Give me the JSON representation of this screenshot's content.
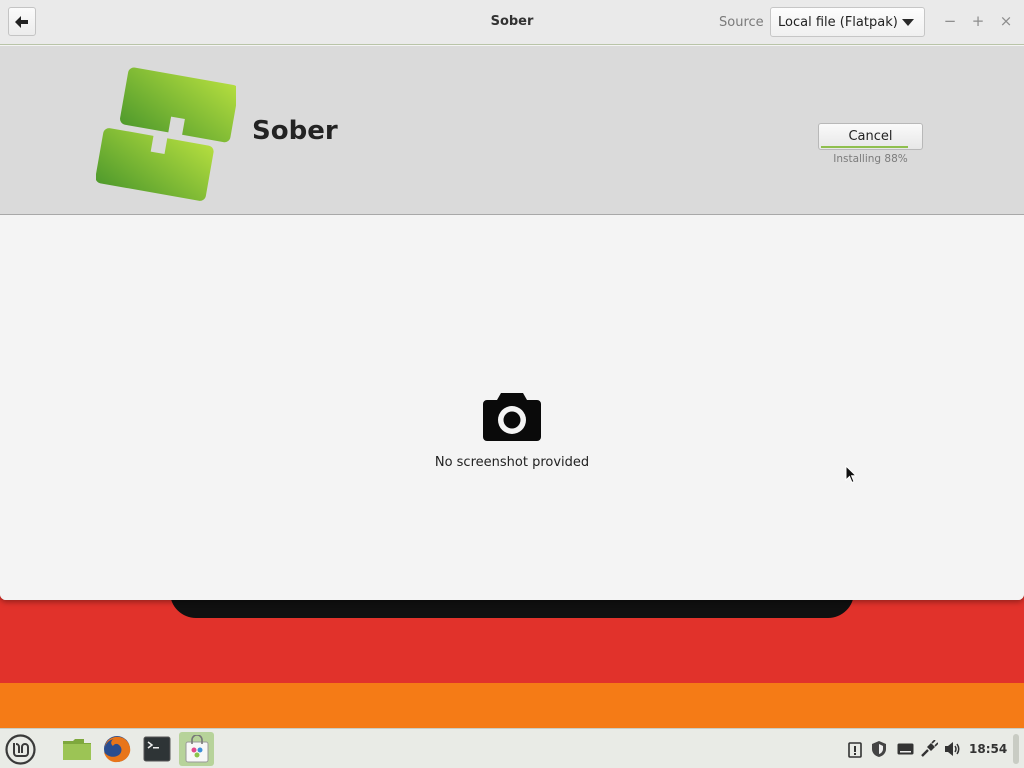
{
  "window": {
    "title": "Sober",
    "source_label": "Source",
    "source_value": "Local file (Flatpak)",
    "window_buttons": {
      "minimize": "−",
      "maximize": "+",
      "close": "×"
    }
  },
  "app": {
    "name": "Sober",
    "icon": "sober-app-icon",
    "cancel_label": "Cancel",
    "install_status": "Installing 88%",
    "install_progress": 0.88
  },
  "content": {
    "placeholder_icon": "camera-icon",
    "placeholder_text": "No screenshot provided"
  },
  "taskbar": {
    "menu_icon": "linux-mint-menu-icon",
    "launchers": [
      {
        "name": "files-icon",
        "active": false
      },
      {
        "name": "firefox-icon",
        "active": false
      },
      {
        "name": "terminal-icon",
        "active": false
      },
      {
        "name": "software-manager-icon",
        "active": true
      }
    ],
    "tray": [
      "clipboard-icon",
      "update-manager-icon",
      "keyboard-icon",
      "network-icon",
      "volume-icon"
    ],
    "clock": "18:54"
  },
  "colors": {
    "accent_green": "#8fbf4e",
    "desktop_red": "#e1322b",
    "desktop_orange": "#f57b16"
  }
}
